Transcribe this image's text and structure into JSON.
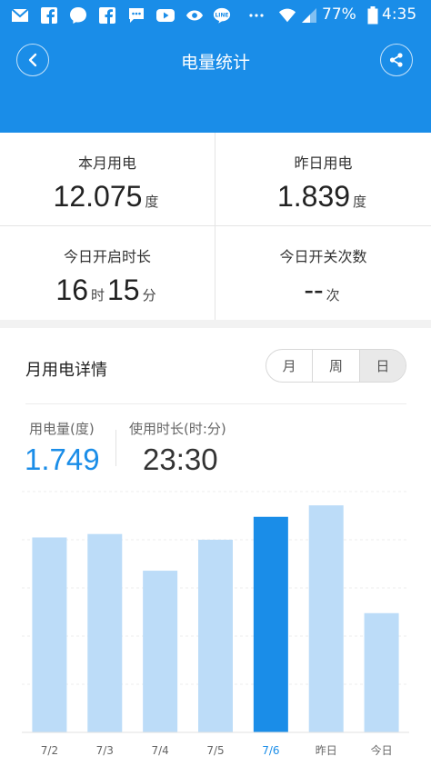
{
  "status_bar": {
    "icons": [
      "mail-icon",
      "facebook-icon",
      "messenger-icon",
      "facebook-icon",
      "chat-icon",
      "youtube-icon",
      "eye-icon",
      "line-icon",
      "more-dots-icon",
      "wifi-icon",
      "signal-icon",
      "battery-icon"
    ],
    "battery_pct": "77%",
    "time": "4:35"
  },
  "header": {
    "title": "电量统计"
  },
  "stats": {
    "month": {
      "label": "本月用电",
      "value": "12.075",
      "unit": "度"
    },
    "yesterday": {
      "label": "昨日用电",
      "value": "1.839",
      "unit": "度"
    },
    "on_duration": {
      "label": "今日开启时长",
      "hours": "16",
      "hours_unit": "时",
      "minutes": "15",
      "minutes_unit": "分"
    },
    "switch_count": {
      "label": "今日开关次数",
      "value": "--",
      "unit": "次"
    }
  },
  "detail": {
    "title": "月用电详情",
    "tabs": [
      {
        "label": "月",
        "active": false
      },
      {
        "label": "周",
        "active": false
      },
      {
        "label": "日",
        "active": true
      }
    ],
    "metric_energy": {
      "label": "用电量(度)",
      "value": "1.749"
    },
    "metric_time": {
      "label": "使用时长(时:分)",
      "value": "23:30"
    }
  },
  "colors": {
    "primary": "#1a8de8",
    "bar_light": "#bcdcf8",
    "bar_selected": "#1a8de8"
  },
  "chart_data": {
    "type": "bar",
    "categories": [
      "7/2",
      "7/3",
      "7/4",
      "7/5",
      "7/6",
      "昨日",
      "今日"
    ],
    "values": [
      1.7,
      1.73,
      1.41,
      1.68,
      1.88,
      1.98,
      1.04
    ],
    "selected_index": 4,
    "ylim": [
      0,
      2.1
    ],
    "grid": true
  }
}
